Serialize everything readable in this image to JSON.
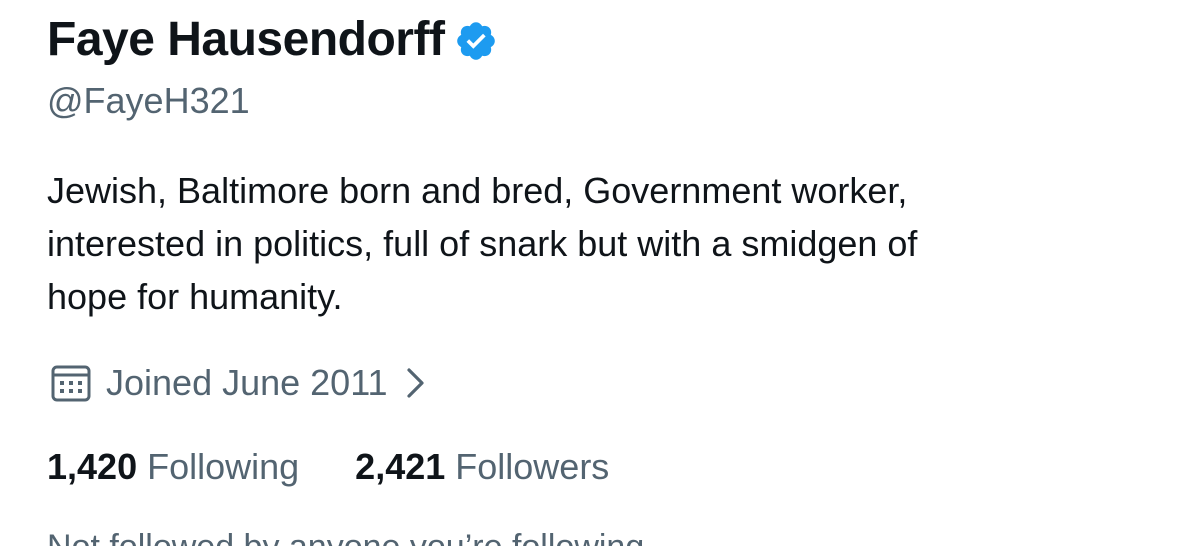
{
  "profile": {
    "display_name": "Faye Hausendorff",
    "verified_badge_icon": "verified-check-icon",
    "verified_color": "#1d9bf0",
    "handle": "@FayeH321",
    "bio_lines": [
      "Jewish, Baltimore born and bred, Government worker,",
      "interested in politics, full of snark but with a smidgen of",
      "hope for humanity."
    ],
    "joined": {
      "icon": "calendar-icon",
      "text": "Joined June 2011",
      "chevron_icon": "chevron-right-icon"
    },
    "stats": {
      "following_count": "1,420",
      "following_label": "Following",
      "followers_count": "2,421",
      "followers_label": "Followers"
    },
    "not_followed_text": "Not followed by anyone you’re following"
  },
  "colors": {
    "text_primary": "#0f1419",
    "text_secondary": "#536471",
    "background": "#ffffff"
  }
}
